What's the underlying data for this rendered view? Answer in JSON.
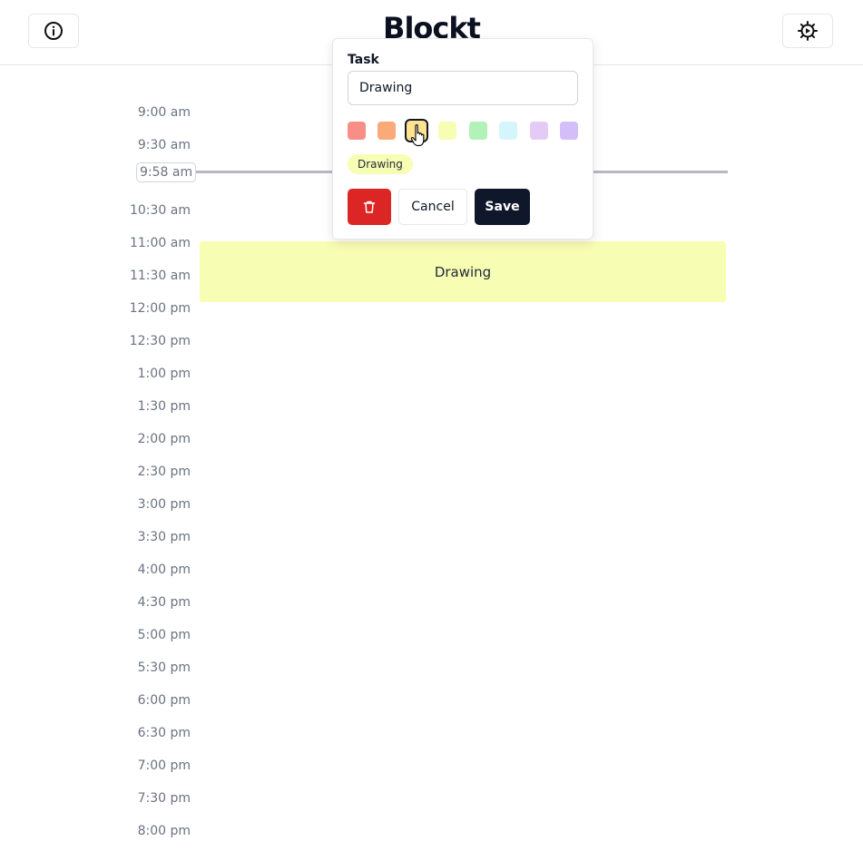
{
  "app": {
    "title": "Blockt"
  },
  "header": {
    "info_icon": "info-icon",
    "settings_icon": "gear-icon"
  },
  "timeline": {
    "labels": [
      "9:00 am",
      "9:30 am",
      "10:30 am",
      "11:00 am",
      "11:30 am",
      "12:00 pm",
      "12:30 pm",
      "1:00 pm",
      "1:30 pm",
      "2:00 pm",
      "2:30 pm",
      "3:00 pm",
      "3:30 pm",
      "4:00 pm",
      "4:30 pm",
      "5:00 pm",
      "5:30 pm",
      "6:00 pm",
      "6:30 pm",
      "7:00 pm",
      "7:30 pm",
      "8:00 pm"
    ],
    "now": "9:58 am"
  },
  "task_block": {
    "label": "Drawing",
    "color": "#f8fdb4"
  },
  "editor": {
    "label": "Task",
    "value": "Drawing",
    "colors": [
      "#f78f87",
      "#f9aa78",
      "#fde28f",
      "#f8fdb4",
      "#b2f2b9",
      "#d4f5fc",
      "#e4cbf6",
      "#d3bef9"
    ],
    "selected_color_index": 2,
    "tag_label": "Drawing",
    "tag_color": "#f8fdb4",
    "delete_icon": "trash-icon",
    "cancel_label": "Cancel",
    "save_label": "Save"
  }
}
